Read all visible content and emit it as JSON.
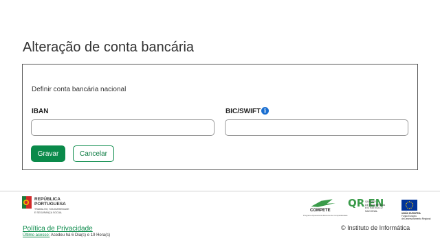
{
  "page": {
    "title": "Alteração de conta bancária"
  },
  "form": {
    "subtitle": "Definir conta bancária nacional",
    "iban_label": "IBAN",
    "iban_value": "",
    "bic_label": "BIC/SWIFT",
    "bic_value": "",
    "info_glyph": "i",
    "save_label": "Gravar",
    "cancel_label": "Cancelar"
  },
  "footer": {
    "republic_line1": "REPÚBLICA",
    "republic_line2": "PORTUGUESA",
    "republic_sub1": "TRABALHO, SOLIDARIEDADE",
    "republic_sub2": "E SEGURANÇA SOCIAL",
    "privacy_link": "Política de Privacidade",
    "last_access_label": "Último acesso:",
    "last_access_value": " Acedeu há 6 Dia(s) e 19 Hora(s)",
    "compete_name": "COMPETE",
    "compete_sub": "Programa Operacional Factores de Competitividade",
    "qren_mark": "QR EN",
    "qren_text1": "QUADRO",
    "qren_text2": "DE REFERÊNCIA",
    "qren_text3": "ESTRATÉGICO",
    "qren_text4": "NACIONAL",
    "eu_text1": "UNIÃO EUROPEIA",
    "eu_text2": "Fundo Europeu",
    "eu_text3": "de Desenvolvimento Regional",
    "copyright": "© Instituto de Informática"
  },
  "colors": {
    "brand_green": "#0a8a4a",
    "info_blue": "#1a6fd1",
    "eu_blue": "#003399",
    "eu_star": "#ffcc00"
  },
  "icons": {
    "info": "info-icon",
    "republic": "portuguese-republic-emblem-icon",
    "compete": "compete-logo-icon",
    "eu": "eu-flag-icon"
  }
}
